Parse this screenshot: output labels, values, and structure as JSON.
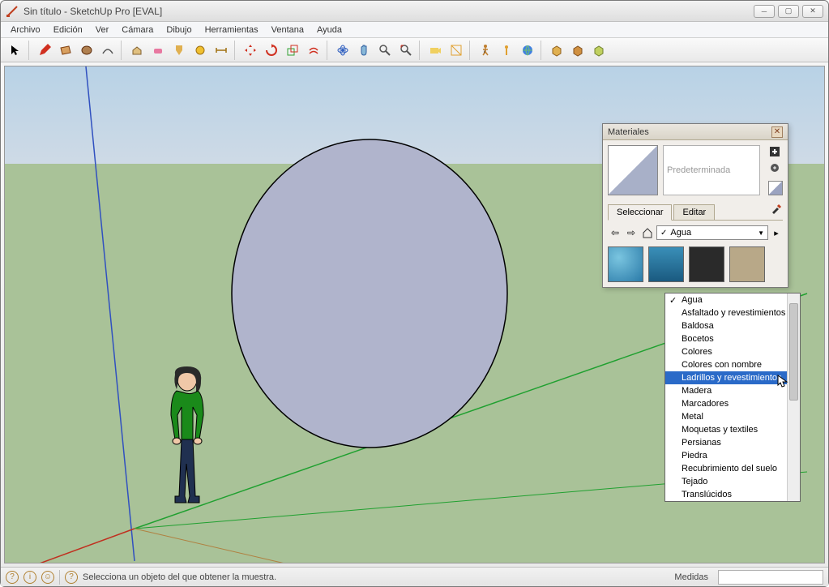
{
  "window": {
    "title": "Sin título - SketchUp Pro [EVAL]"
  },
  "menus": [
    "Archivo",
    "Edición",
    "Ver",
    "Cámara",
    "Dibujo",
    "Herramientas",
    "Ventana",
    "Ayuda"
  ],
  "toolbar_icons": [
    "select",
    "pencil",
    "rectangle",
    "circle",
    "arc",
    "push",
    "eraser",
    "paint",
    "tape",
    "swatch",
    "move",
    "rotate",
    "scale",
    "offset",
    "orbit",
    "pan",
    "zoom",
    "zoom-ext",
    "camera",
    "section",
    "man",
    "layers",
    "globe",
    "box1",
    "box2",
    "add"
  ],
  "materials": {
    "panel_title": "Materiales",
    "default_name": "Predeterminada",
    "tabs": {
      "select": "Seleccionar",
      "edit": "Editar"
    },
    "combo_selected": "Agua",
    "thumbs": [
      "th-water1",
      "th-water2",
      "th-dark",
      "th-sand"
    ],
    "dropdown": [
      {
        "label": "Agua",
        "checked": true
      },
      {
        "label": "Asfaltado y revestimientos"
      },
      {
        "label": "Baldosa"
      },
      {
        "label": "Bocetos"
      },
      {
        "label": "Colores"
      },
      {
        "label": "Colores con nombre"
      },
      {
        "label": "Ladrillos y revestimientos",
        "hl": true
      },
      {
        "label": "Madera"
      },
      {
        "label": "Marcadores"
      },
      {
        "label": "Metal"
      },
      {
        "label": "Moquetas y textiles"
      },
      {
        "label": "Persianas"
      },
      {
        "label": "Piedra"
      },
      {
        "label": "Recubrimiento del suelo"
      },
      {
        "label": "Tejado"
      },
      {
        "label": "Translúcidos"
      }
    ]
  },
  "status": {
    "hint": "Selecciona un objeto del que obtener la muestra.",
    "measure_label": "Medidas"
  }
}
